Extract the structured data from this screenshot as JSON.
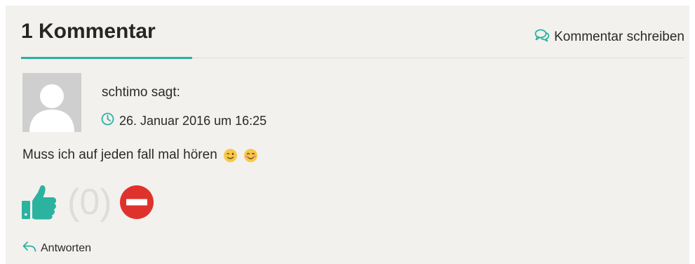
{
  "comments_header": {
    "title": "1 Kommentar",
    "write_label": "Kommentar schreiben"
  },
  "comment": {
    "author_line": "schtimo sagt:",
    "date": "26. Januar 2016 um 16:25",
    "text": "Muss ich auf jeden fall mal hören",
    "emojis": [
      "winking-face-emoji",
      "smiling-blushing-face-emoji"
    ],
    "vote_count": "(0)",
    "reply_label": "Antworten"
  },
  "colors": {
    "accent": "#2bb3a0",
    "dislike": "#e0322d",
    "panel_bg": "#f2f1ee",
    "count_text": "#dedddb"
  },
  "icons": {
    "write": "speech-bubbles-icon",
    "date": "clock-icon",
    "like": "thumbs-up-icon",
    "dislike": "minus-circle-icon",
    "reply": "reply-arrow-icon"
  }
}
